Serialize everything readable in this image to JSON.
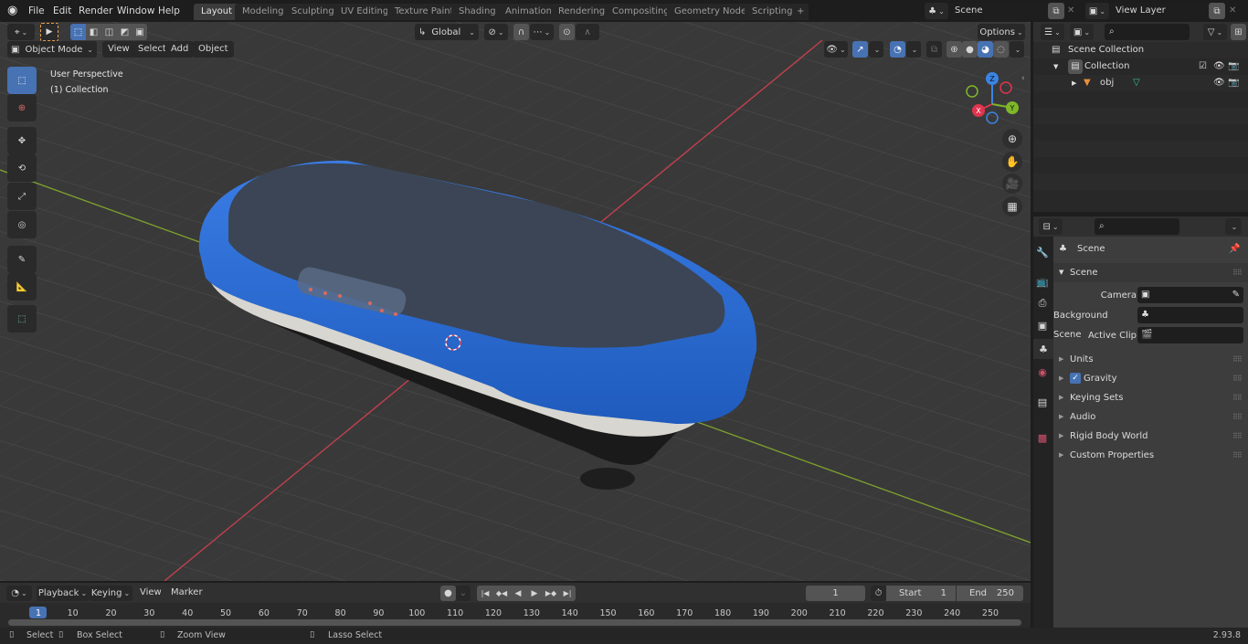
{
  "app": {
    "version": "2.93.8"
  },
  "menu": [
    "File",
    "Edit",
    "Render",
    "Window",
    "Help"
  ],
  "workspaces": [
    {
      "label": "Layout",
      "active": true
    },
    {
      "label": "Modeling"
    },
    {
      "label": "Sculpting"
    },
    {
      "label": "UV Editing"
    },
    {
      "label": "Texture Paint"
    },
    {
      "label": "Shading"
    },
    {
      "label": "Animation"
    },
    {
      "label": "Rendering"
    },
    {
      "label": "Compositing"
    },
    {
      "label": "Geometry Nodes"
    },
    {
      "label": "Scripting"
    }
  ],
  "add_workspace": "+",
  "scene_selector": {
    "value": "Scene"
  },
  "view_layer_selector": {
    "value": "View Layer"
  },
  "viewport": {
    "mode": "Object Mode",
    "menus": [
      "View",
      "Select",
      "Add",
      "Object"
    ],
    "transform_orientation": "Global",
    "options_label": "Options",
    "overlay_text": [
      "User Perspective",
      "(1) Collection"
    ],
    "tools": [
      "select-box",
      "cursor",
      "move",
      "rotate",
      "scale",
      "transform",
      "annotate",
      "measure",
      "add-cube"
    ],
    "gizmo": {
      "x": "X",
      "y": "Y",
      "z": "Z"
    },
    "colors": {
      "x_axis": "#e0344f",
      "y_axis": "#7fb729",
      "z_axis": "#3b84e3",
      "accent": "#4772b3",
      "model_blue": "#2f6fd8"
    }
  },
  "outliner": {
    "rows": [
      {
        "label": "Scene Collection"
      },
      {
        "label": "Collection"
      },
      {
        "label": "obj"
      }
    ]
  },
  "properties": {
    "context_title": "Scene",
    "panel_title": "Scene",
    "fields": [
      {
        "label": "Camera",
        "value": ""
      },
      {
        "label": "Background Scene",
        "value": ""
      },
      {
        "label": "Active Clip",
        "value": ""
      }
    ],
    "subpanels": [
      {
        "label": "Units"
      },
      {
        "label": "Gravity",
        "checked": true
      },
      {
        "label": "Keying Sets"
      },
      {
        "label": "Audio"
      },
      {
        "label": "Rigid Body World"
      },
      {
        "label": "Custom Properties"
      }
    ]
  },
  "timeline": {
    "menus": [
      "Playback",
      "Keying",
      "View",
      "Marker"
    ],
    "current_frame": "1",
    "start_label": "Start",
    "start": "1",
    "end_label": "End",
    "end": "250",
    "ticks": [
      "1",
      "10",
      "20",
      "30",
      "40",
      "50",
      "60",
      "70",
      "80",
      "90",
      "100",
      "110",
      "120",
      "130",
      "140",
      "150",
      "160",
      "170",
      "180",
      "190",
      "200",
      "210",
      "220",
      "230",
      "240",
      "250"
    ]
  },
  "statusbar": {
    "items": [
      "Select",
      "Box Select",
      "Zoom View",
      "Lasso Select"
    ]
  }
}
